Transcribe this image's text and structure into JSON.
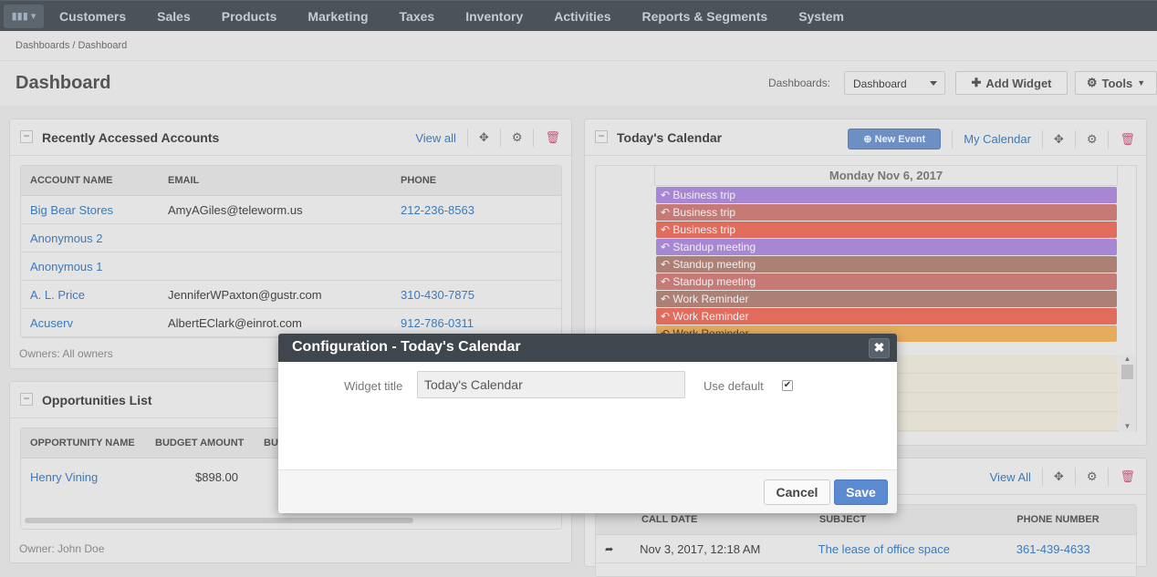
{
  "nav": {
    "logo_icon": "bar-chart-icon",
    "items": [
      "Customers",
      "Sales",
      "Products",
      "Marketing",
      "Taxes",
      "Inventory",
      "Activities",
      "Reports & Segments",
      "System"
    ]
  },
  "breadcrumb": "Dashboards / Dashboard",
  "page": {
    "title": "Dashboard",
    "dashboards_label": "Dashboards:",
    "dashboard_select": "Dashboard",
    "add_widget": "Add Widget",
    "tools": "Tools"
  },
  "accounts": {
    "title": "Recently Accessed Accounts",
    "view_all": "View all",
    "columns": [
      "ACCOUNT NAME",
      "EMAIL",
      "PHONE"
    ],
    "rows": [
      [
        "Big Bear Stores",
        "AmyAGiles@teleworm.us",
        "212-236-8563"
      ],
      [
        "Anonymous 2",
        "",
        ""
      ],
      [
        "Anonymous 1",
        "",
        ""
      ],
      [
        "A. L. Price",
        "JenniferWPaxton@gustr.com",
        "310-430-7875"
      ],
      [
        "Acuserv",
        "AlbertEClark@einrot.com",
        "912-786-0311"
      ]
    ],
    "footer": "Owners: All owners"
  },
  "opportunities": {
    "title": "Opportunities List",
    "columns": [
      "OPPORTUNITY NAME",
      "BUDGET AMOUNT",
      "BU"
    ],
    "rows": [
      [
        "Henry Vining",
        "$898.00"
      ]
    ],
    "footer": "Owner: John Doe"
  },
  "calendar": {
    "title": "Today's Calendar",
    "new_event": "New Event",
    "my_calendar": "My Calendar",
    "date": "Monday Nov 6, 2017",
    "events": [
      {
        "label": "Business trip",
        "color": "#a787d4"
      },
      {
        "label": "Business trip",
        "color": "#c67a76"
      },
      {
        "label": "Business trip",
        "color": "#e26c5c"
      },
      {
        "label": "Standup meeting",
        "color": "#a787d4"
      },
      {
        "label": "Standup meeting",
        "color": "#ac8074"
      },
      {
        "label": "Standup meeting",
        "color": "#c67a76"
      },
      {
        "label": "Work Reminder",
        "color": "#ac8074"
      },
      {
        "label": "Work Reminder",
        "color": "#e26c5c"
      },
      {
        "label": "Work Reminder",
        "color": "#e6ac5e"
      }
    ]
  },
  "calls": {
    "view_all": "View All",
    "columns": [
      "CALL DATE",
      "SUBJECT",
      "PHONE NUMBER"
    ],
    "rows": [
      [
        "Nov 3, 2017, 12:18 AM",
        "The lease of office space",
        "361-439-4633"
      ]
    ]
  },
  "modal": {
    "title": "Configuration - Today's Calendar",
    "widget_title_label": "Widget title",
    "widget_title_value": "Today's Calendar",
    "use_default_label": "Use default",
    "use_default_checked": true,
    "cancel": "Cancel",
    "save": "Save"
  }
}
